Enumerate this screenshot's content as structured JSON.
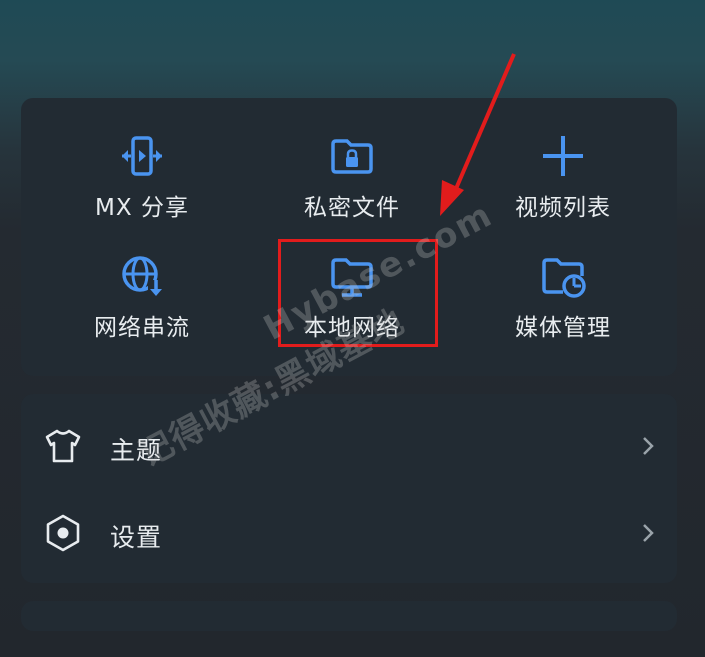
{
  "colors": {
    "accent": "#4a94f0",
    "card_bg": "#222b33",
    "text": "#e8ecef",
    "annotation_red": "#e21c1c"
  },
  "grid": {
    "items": [
      {
        "label": "MX 分享",
        "icon": "mx-share-icon"
      },
      {
        "label": "私密文件",
        "icon": "private-folder-lock-icon"
      },
      {
        "label": "视频列表",
        "icon": "plus-icon"
      },
      {
        "label": "网络串流",
        "icon": "globe-download-icon"
      },
      {
        "label": "本地网络",
        "icon": "folder-monitor-icon"
      },
      {
        "label": "媒体管理",
        "icon": "folder-pie-chart-icon"
      }
    ]
  },
  "menu": {
    "items": [
      {
        "label": "主题",
        "icon": "tshirt-icon",
        "chevron": "chevron-right-icon"
      },
      {
        "label": "设置",
        "icon": "hexagon-settings-icon",
        "chevron": "chevron-right-icon"
      }
    ]
  },
  "watermark": {
    "line1": "记得收藏:黑域基地",
    "line2": "Hybase.com"
  }
}
